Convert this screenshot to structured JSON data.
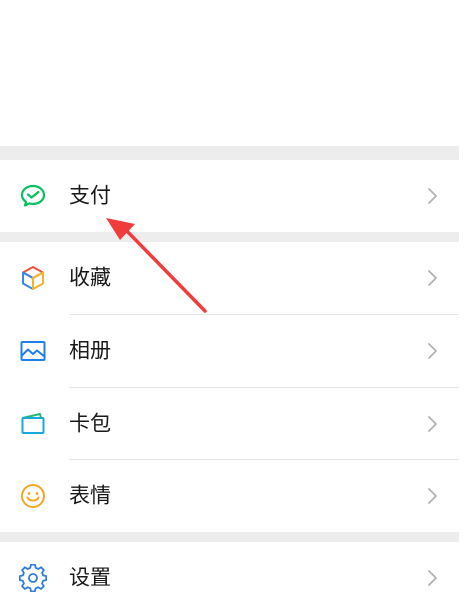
{
  "menu": {
    "items": [
      {
        "id": "pay",
        "label": "支付",
        "icon": "wechat-pay-icon"
      },
      {
        "id": "favorites",
        "label": "收藏",
        "icon": "cube-icon"
      },
      {
        "id": "album",
        "label": "相册",
        "icon": "picture-icon"
      },
      {
        "id": "cards",
        "label": "卡包",
        "icon": "wallet-icon"
      },
      {
        "id": "stickers",
        "label": "表情",
        "icon": "smiley-icon"
      },
      {
        "id": "settings",
        "label": "设置",
        "icon": "gear-icon"
      }
    ]
  },
  "colors": {
    "pay_icon": "#07c160",
    "album_icon": "#1f7ee8",
    "cards_icon": "#1aa8d8",
    "stickers_icon": "#f5a623",
    "settings_icon": "#2f7dd8",
    "annotation_arrow": "#f03c3c",
    "section_gap": "#ededed"
  }
}
